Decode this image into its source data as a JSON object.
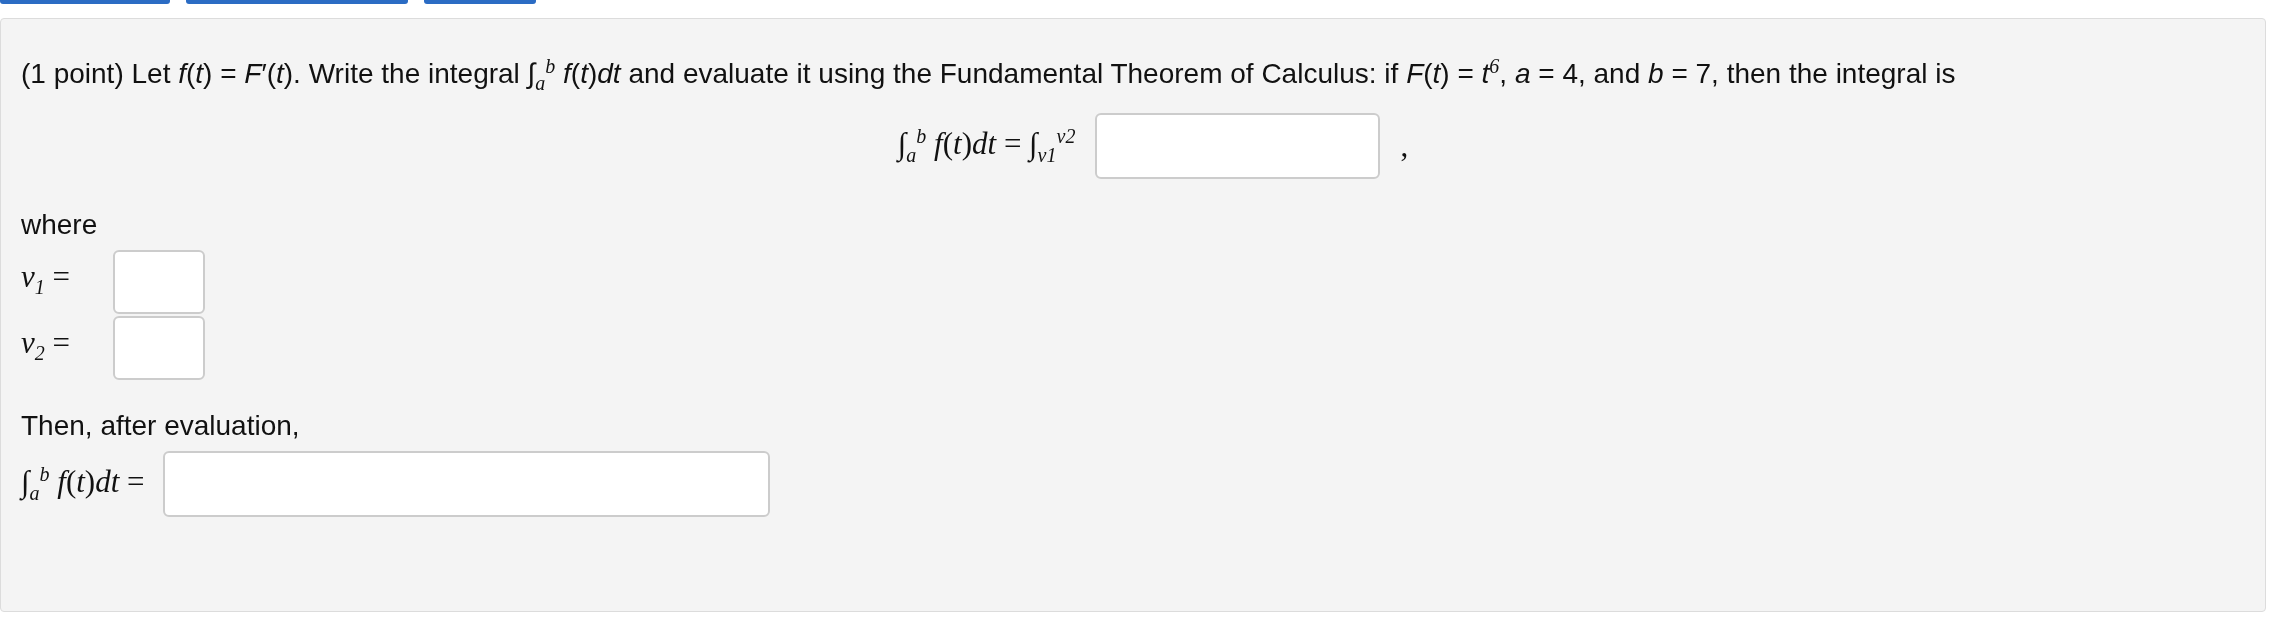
{
  "problem": {
    "statement": "(1 point) Let *f*(*t*) = *F*′(*t*). Write the integral ∫$_{a}$$^{b}$ *f*(*t*)*dt* and evaluate it using the Fundamental Theorem of Calculus: if *F*(*t*) = *t*$^{6}$, *a* = 4, and *b* = 7, then the integral is",
    "display": {
      "lhs": "∫$_{a}$$^{b}$ *f*(*t*)*dt* = ∫$_{v1}$$^{v2}$",
      "trailing": ","
    },
    "where": "where",
    "limits": [
      {
        "label": "*v*$_{1}$ ="
      },
      {
        "label": "*v*$_{2}$ ="
      }
    ],
    "then": "Then, after evaluation,",
    "result": {
      "label": "∫$_{a}$$^{b}$ *f*(*t*)*dt* ="
    }
  }
}
